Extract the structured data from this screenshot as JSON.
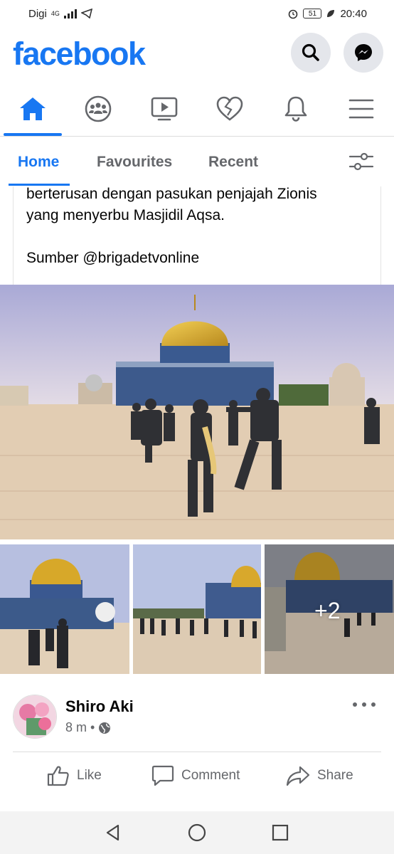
{
  "status_bar": {
    "carrier": "Digi",
    "network": "4G",
    "time": "20:40",
    "battery": "51"
  },
  "header": {
    "logo": "facebook",
    "search_icon": "search-icon",
    "messenger_icon": "messenger-icon"
  },
  "nav": {
    "items": [
      "home-icon",
      "groups-icon",
      "watch-icon",
      "dating-icon",
      "notifications-icon",
      "menu-icon"
    ],
    "active": "home-icon",
    "accent": "#1877f2"
  },
  "feed_filter": {
    "tabs": [
      {
        "label": "Home",
        "active": true
      },
      {
        "label": "Favourites",
        "active": false
      },
      {
        "label": "Recent",
        "active": false
      }
    ]
  },
  "post": {
    "text_line1": "berterusan dengan pasukan penjajah Zionis",
    "text_line2": "yang menyerbu Masjidil Aqsa.",
    "source": "Sumber @brigadetvonline",
    "more_photos": "+2"
  },
  "next_post": {
    "author": "Shiro Aki",
    "time": "8 m",
    "separator": "•",
    "privacy_icon": "globe-icon"
  },
  "actions": {
    "like": "Like",
    "comment": "Comment",
    "share": "Share"
  }
}
